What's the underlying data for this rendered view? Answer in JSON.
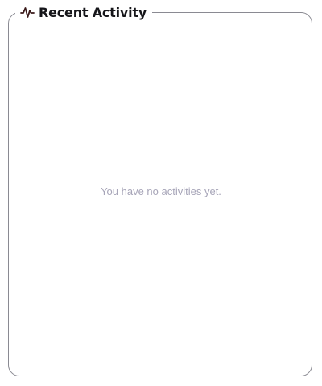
{
  "panel": {
    "title": "Recent Activity",
    "icon": "activity-pulse-icon",
    "empty_message": "You have no activities yet."
  },
  "colors": {
    "title_text": "#16161a",
    "icon_stroke": "#3a1a1a",
    "border": "#8a8a92",
    "empty_text": "#a7a5b8"
  }
}
